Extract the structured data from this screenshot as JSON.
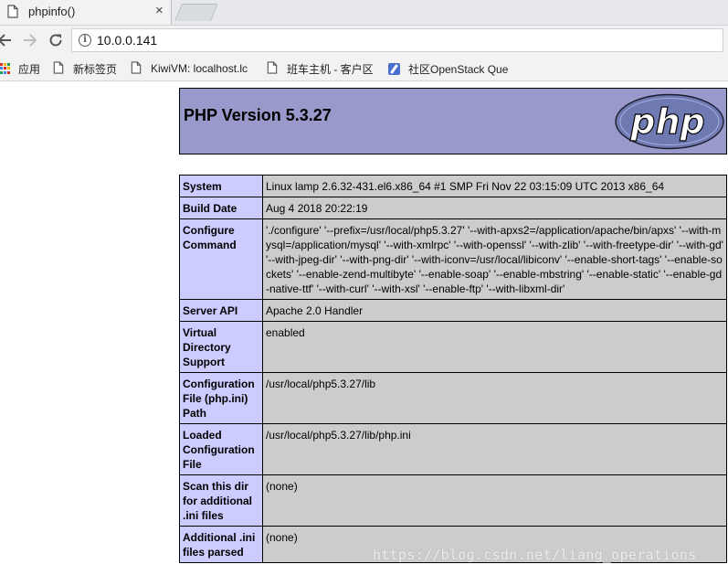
{
  "browser": {
    "tab_title": "phpinfo()",
    "tab_close": "×",
    "url": "10.0.0.141",
    "bookmarks": [
      {
        "label": "应用",
        "icon": "apps-grid-icon"
      },
      {
        "label": "新标签页",
        "icon": "document-icon"
      },
      {
        "label": "KiwiVM: localhost.lc",
        "icon": "document-icon"
      },
      {
        "label": "班车主机 - 客户区",
        "icon": "document-icon"
      },
      {
        "label": "社区OpenStack Que",
        "icon": "openstack-icon"
      }
    ]
  },
  "php": {
    "title": "PHP Version 5.3.27",
    "logo_text": "php",
    "rows": [
      {
        "key": "System",
        "value": "Linux lamp 2.6.32-431.el6.x86_64 #1 SMP Fri Nov 22 03:15:09 UTC 2013 x86_64"
      },
      {
        "key": "Build Date",
        "value": "Aug 4 2018 20:22:19"
      },
      {
        "key": "Configure Command",
        "value": "'./configure' '--prefix=/usr/local/php5.3.27' '--with-apxs2=/application/apache/bin/apxs' '--with-mysql=/application/mysql' '--with-xmlrpc' '--with-openssl' '--with-zlib' '--with-freetype-dir' '--with-gd' '--with-jpeg-dir' '--with-png-dir' '--with-iconv=/usr/local/libiconv' '--enable-short-tags' '--enable-sockets' '--enable-zend-multibyte' '--enable-soap' '--enable-mbstring' '--enable-static' '--enable-gd-native-ttf' '--with-curl' '--with-xsl' '--enable-ftp' '--with-libxml-dir'"
      },
      {
        "key": "Server API",
        "value": "Apache 2.0 Handler"
      },
      {
        "key": "Virtual Directory Support",
        "value": "enabled"
      },
      {
        "key": "Configuration File (php.ini) Path",
        "value": "/usr/local/php5.3.27/lib"
      },
      {
        "key": "Loaded Configuration File",
        "value": "/usr/local/php5.3.27/lib/php.ini"
      },
      {
        "key": "Scan this dir for additional .ini files",
        "value": "(none)"
      },
      {
        "key": "Additional .ini files parsed",
        "value": "(none)"
      }
    ]
  },
  "watermark": "https://blog.csdn.net/liang_operations",
  "colors": {
    "header_bg": "#9999cc",
    "key_bg": "#ccccff",
    "value_bg": "#cccccc"
  }
}
